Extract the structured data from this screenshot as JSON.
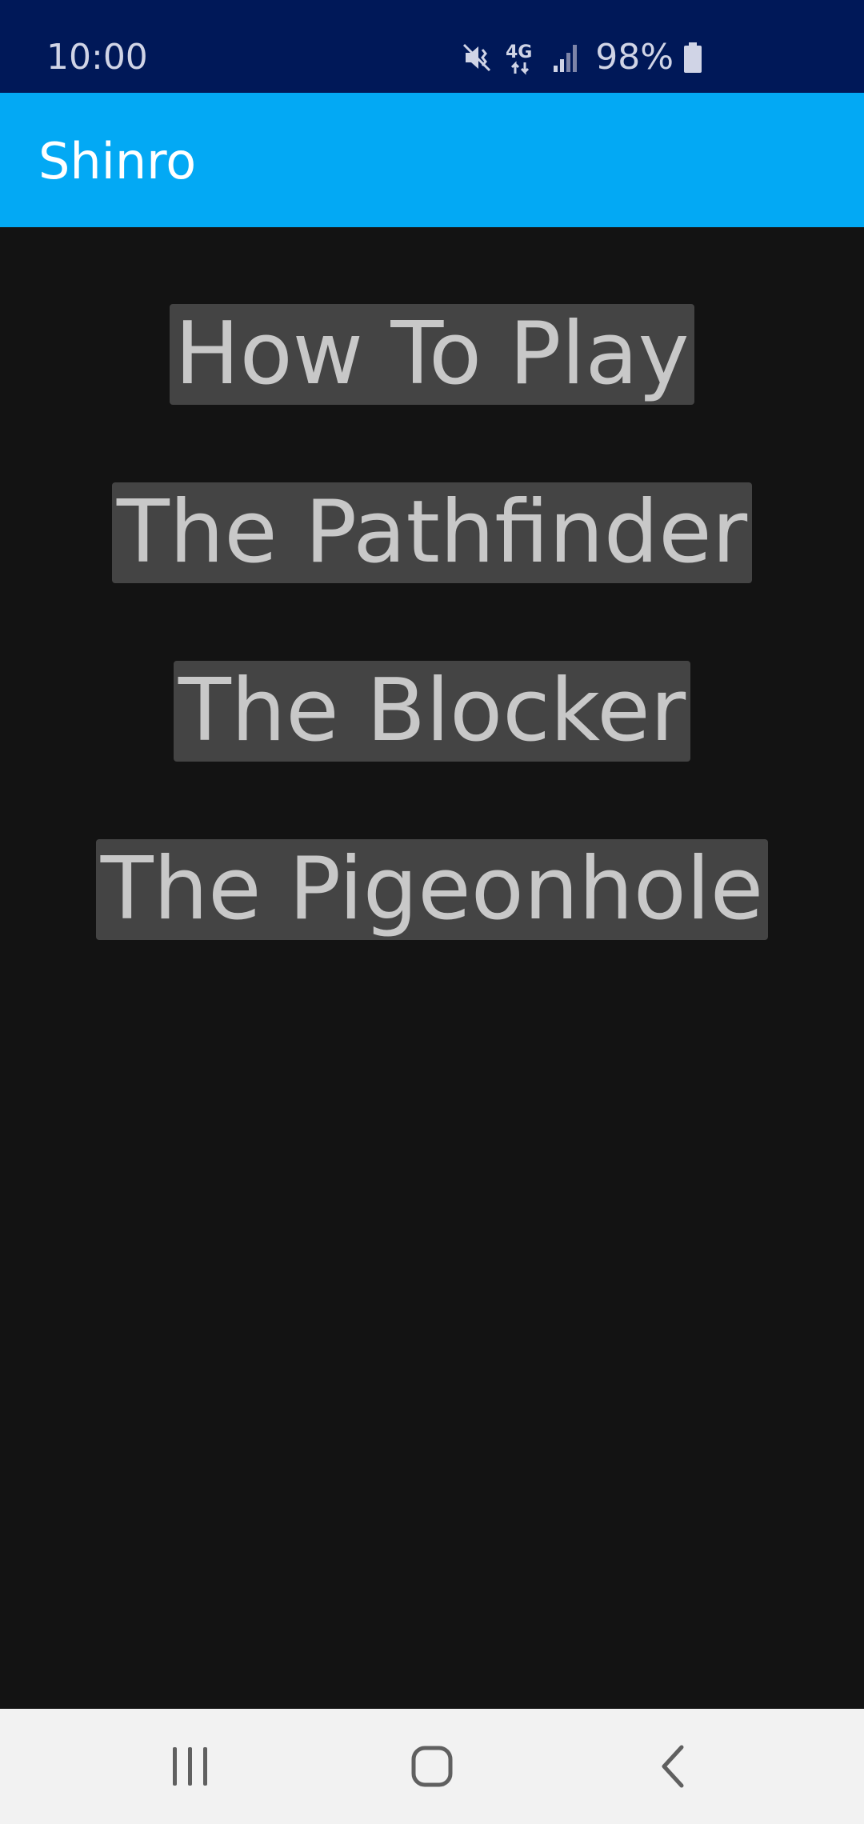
{
  "status_bar": {
    "time": "10:00",
    "battery_percent": "98%",
    "network_type": "4G",
    "icons": [
      "mute-vibrate-icon",
      "4g-data-icon",
      "signal-strength-icon",
      "battery-icon"
    ]
  },
  "app_bar": {
    "title": "Shinro",
    "color": "#03a9f4"
  },
  "menu": {
    "items": [
      {
        "label": "How To Play"
      },
      {
        "label": "The Pathfinder"
      },
      {
        "label": "The Blocker"
      },
      {
        "label": "The Pigeonhole"
      }
    ]
  },
  "nav_bar": {
    "icons": [
      "recent-apps-icon",
      "home-icon",
      "back-icon"
    ]
  },
  "colors": {
    "status_bar": "#001858",
    "background": "#131313",
    "menu_item_bg": "#444444",
    "menu_item_text": "#c8c8c8"
  }
}
